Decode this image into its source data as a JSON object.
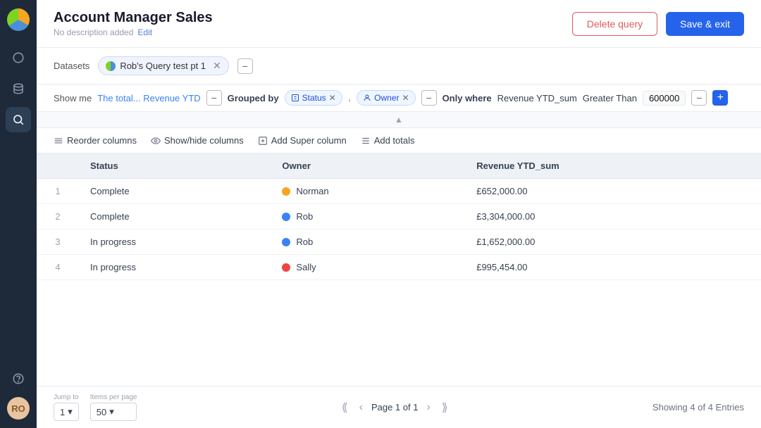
{
  "sidebar": {
    "logo": "logo",
    "items": [
      {
        "id": "circle",
        "icon": "○",
        "active": false
      },
      {
        "id": "database",
        "icon": "⬡",
        "active": false
      },
      {
        "id": "search",
        "icon": "⌕",
        "active": true
      }
    ],
    "bottom": [
      {
        "id": "help",
        "icon": "?"
      },
      {
        "id": "avatar",
        "initials": "RO"
      }
    ]
  },
  "header": {
    "title": "Account Manager Sales",
    "description": "No description added",
    "edit_label": "Edit",
    "delete_label": "Delete query",
    "save_label": "Save & exit"
  },
  "datasets": {
    "label": "Datasets",
    "items": [
      {
        "name": "Rob's Query test pt 1"
      }
    ]
  },
  "showme": {
    "label": "Show me",
    "revenue_label": "The total... Revenue YTD",
    "grouped_by_label": "Grouped by",
    "tags": [
      {
        "id": "status",
        "label": "Status"
      },
      {
        "id": "owner",
        "label": "Owner"
      }
    ],
    "only_where_label": "Only where",
    "condition_field": "Revenue YTD_sum",
    "condition_op": "Greater Than",
    "condition_value": "600000"
  },
  "table_toolbar": {
    "reorder_label": "Reorder columns",
    "showhide_label": "Show/hide columns",
    "super_label": "Add Super column",
    "totals_label": "Add totals"
  },
  "table": {
    "columns": [
      "",
      "Status",
      "Owner",
      "Revenue YTD_sum"
    ],
    "rows": [
      {
        "num": "1",
        "status": "Complete",
        "owner": "Norman",
        "owner_color": "#f5a623",
        "revenue": "£652,000.00"
      },
      {
        "num": "2",
        "status": "Complete",
        "owner": "Rob",
        "owner_color": "#3b82f6",
        "revenue": "£3,304,000.00"
      },
      {
        "num": "3",
        "status": "In progress",
        "owner": "Rob",
        "owner_color": "#3b82f6",
        "revenue": "£1,652,000.00"
      },
      {
        "num": "4",
        "status": "In progress",
        "owner": "Sally",
        "owner_color": "#ef4444",
        "revenue": "£995,454.00"
      }
    ]
  },
  "footer": {
    "jump_to_label": "Jump to",
    "jump_to_value": "1",
    "items_per_page_label": "Items per page",
    "items_per_page_value": "50",
    "page_label": "Page 1 of 1",
    "showing_label": "Showing 4 of 4 Entries"
  }
}
